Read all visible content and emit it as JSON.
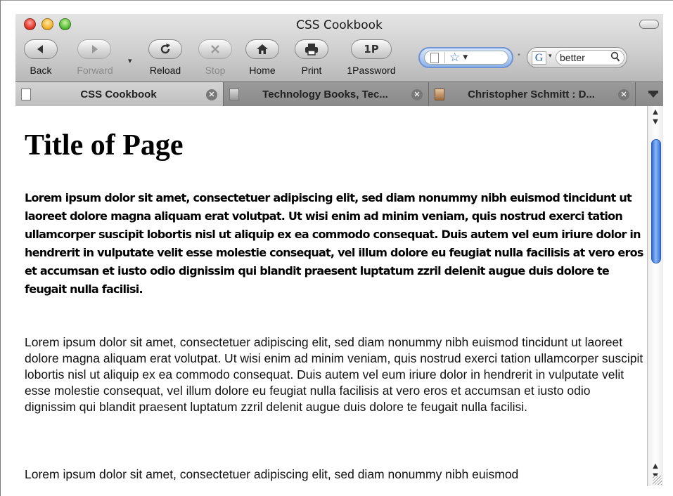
{
  "window": {
    "title": "CSS Cookbook"
  },
  "toolbar": {
    "back_label": "Back",
    "forward_label": "Forward",
    "reload_label": "Reload",
    "stop_label": "Stop",
    "home_label": "Home",
    "print_label": "Print",
    "password_label": "1Password",
    "password_glyph": "1P",
    "search_value": "better",
    "search_engine_glyph": "G"
  },
  "tabs": [
    {
      "label": "CSS Cookbook",
      "active": true
    },
    {
      "label": "Technology Books, Tec...",
      "active": false
    },
    {
      "label": "Christopher Schmitt : D...",
      "active": false
    }
  ],
  "page": {
    "title": "Title of Page",
    "bold_paragraph": "Lorem ipsum dolor sit amet, consectetuer adipiscing elit, sed diam nonummy nibh euismod tincidunt ut laoreet dolore magna aliquam erat volutpat. Ut wisi enim ad minim veniam, quis nostrud exerci tation ullamcorper suscipit lobortis nisl ut aliquip ex ea commodo consequat. Duis autem vel eum iriure dolor in hendrerit in vulputate velit esse molestie consequat, vel illum dolore eu feugiat nulla facilisis at vero eros et accumsan et iusto odio dignissim qui blandit praesent luptatum zzril delenit augue duis dolore te feugait nulla facilisi.",
    "paragraph_1": "Lorem ipsum dolor sit amet, consectetuer adipiscing elit, sed diam nonummy nibh euismod tincidunt ut laoreet dolore magna aliquam erat volutpat. Ut wisi enim ad minim veniam, quis nostrud exerci tation ullamcorper suscipit lobortis nisl ut aliquip ex ea commodo consequat. Duis autem vel eum iriure dolor in hendrerit in vulputate velit esse molestie consequat, vel illum dolore eu feugiat nulla facilisis at vero eros et accumsan et iusto odio dignissim qui blandit praesent luptatum zzril delenit augue duis dolore te feugait nulla facilisi.",
    "paragraph_2": "Lorem ipsum dolor sit amet, consectetuer adipiscing elit, sed diam nonummy nibh euismod"
  },
  "colors": {
    "close": "#e33a2e",
    "minimize": "#f2b533",
    "zoom": "#5cbf3a",
    "scroll_thumb": "#3a74d8"
  },
  "icons": [
    "back-arrow-icon",
    "forward-arrow-icon",
    "reload-icon",
    "stop-icon",
    "home-icon",
    "printer-icon",
    "bookmark-star-icon",
    "search-icon",
    "tab-close-icon"
  ]
}
